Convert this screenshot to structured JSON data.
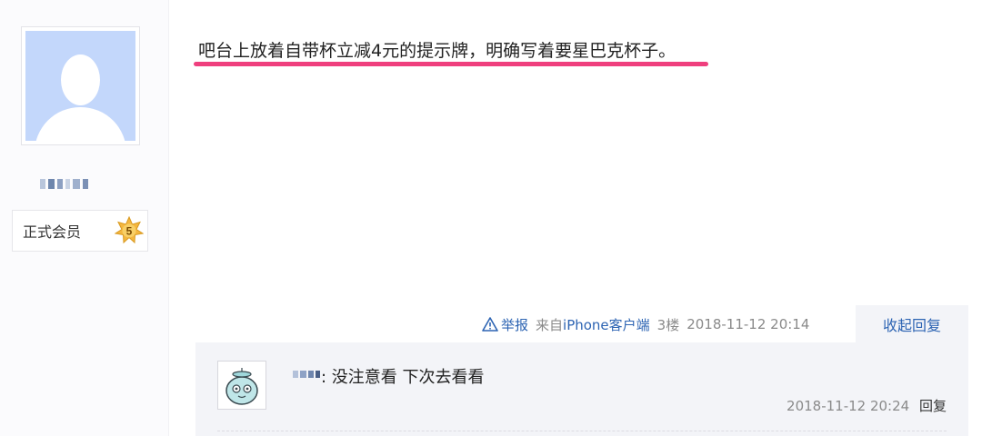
{
  "author": {
    "avatar_icon": "default-user-avatar-icon",
    "member_label": "正式会员",
    "level": "5"
  },
  "post": {
    "text": "吧台上放着自带杯立减4元的提示牌，明确写着要星巴克杯子。",
    "report_label": "举报",
    "source": "来自iPhone客户端",
    "floor": "3楼",
    "timestamp": "2018-11-12 20:14",
    "collapse_label": "收起回复",
    "highlight_color": "#ef3f7e",
    "link_color": "#2d64b3"
  },
  "reply": {
    "text": ": 没注意看 下次去看看",
    "timestamp": "2018-11-12 20:24",
    "reply_label": "回复"
  }
}
